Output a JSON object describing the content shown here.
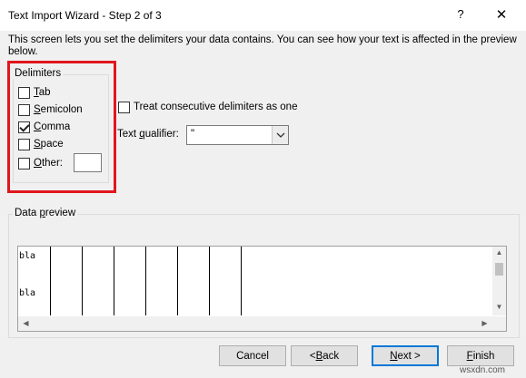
{
  "window": {
    "title": "Text Import Wizard - Step 2 of 3",
    "help_glyph": "?",
    "close_glyph": "✕"
  },
  "intro_text": "This screen lets you set the delimiters your data contains.  You can see how your text is affected in the preview below.",
  "delimiters": {
    "legend": "Delimiters",
    "items": [
      {
        "key": "T",
        "rest": "ab",
        "checked": false
      },
      {
        "key": "S",
        "rest": "emicolon",
        "checked": false
      },
      {
        "key": "C",
        "rest": "omma",
        "checked": true
      },
      {
        "key": "S",
        "rest": "pace",
        "checked": false
      },
      {
        "key": "O",
        "rest": "ther:",
        "checked": false
      }
    ],
    "other_value": ""
  },
  "consecutive": {
    "label": "Treat consecutive delimiters as one",
    "checked": false
  },
  "qualifier": {
    "label_pre": "Text ",
    "label_key": "q",
    "label_post": "ualifier:",
    "value": "\""
  },
  "preview": {
    "legend_pre": "Data ",
    "legend_key": "p",
    "legend_post": "review",
    "rows": [
      "bla",
      "bla"
    ]
  },
  "buttons": {
    "cancel": "Cancel",
    "back_pre": "< ",
    "back_key": "B",
    "back_post": "ack",
    "next_key": "N",
    "next_post": "ext >",
    "finish_key": "F",
    "finish_post": "inish"
  },
  "watermark": "wsxdn.com",
  "colors": {
    "highlight": "#e0161d",
    "default_button_border": "#0078d7"
  }
}
